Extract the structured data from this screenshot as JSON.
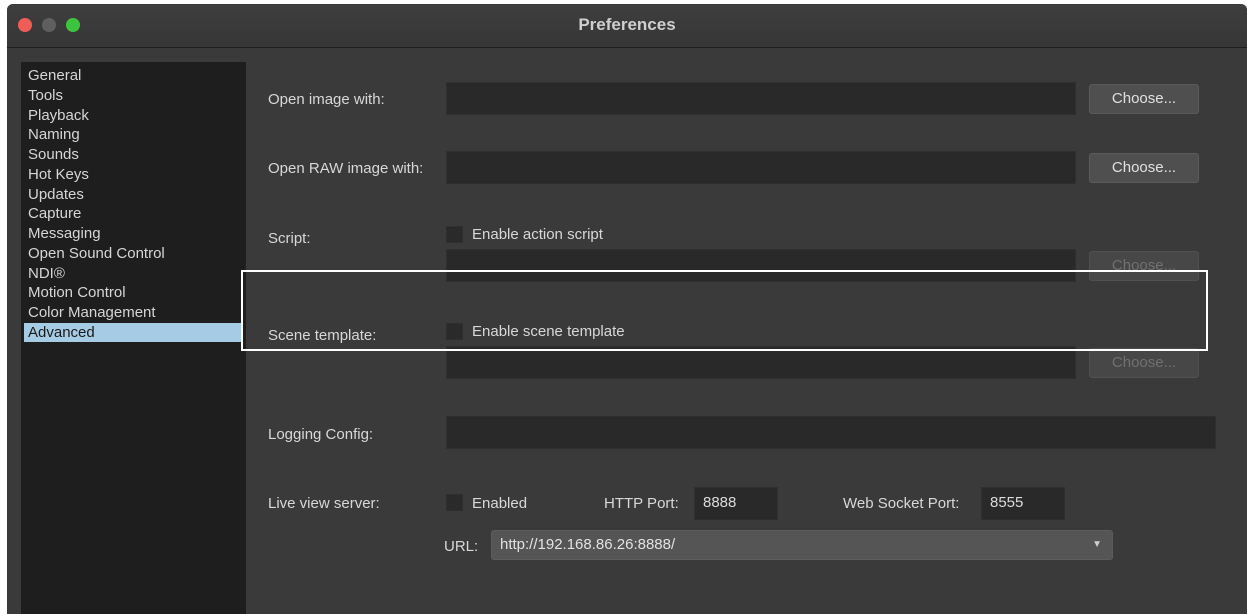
{
  "window": {
    "title": "Preferences"
  },
  "colors": {
    "close": "#ee5e56",
    "minimize": "#5f5f5f",
    "zoom": "#3cc43f",
    "selection": "#a6cbe5",
    "highlight_frame": "#ffffff"
  },
  "sidebar": {
    "items": [
      {
        "label": "General"
      },
      {
        "label": "Tools"
      },
      {
        "label": "Playback"
      },
      {
        "label": "Naming"
      },
      {
        "label": "Sounds"
      },
      {
        "label": "Hot Keys"
      },
      {
        "label": "Updates"
      },
      {
        "label": "Capture"
      },
      {
        "label": "Messaging"
      },
      {
        "label": "Open Sound Control"
      },
      {
        "label": "NDI®"
      },
      {
        "label": "Motion Control"
      },
      {
        "label": "Color Management"
      },
      {
        "label": "Advanced",
        "selected": true
      }
    ]
  },
  "advanced": {
    "open_image": {
      "label": "Open image with:",
      "value": "",
      "button": "Choose..."
    },
    "open_raw": {
      "label": "Open RAW image with:",
      "value": "",
      "button": "Choose..."
    },
    "script": {
      "label": "Script:",
      "checkbox_label": "Enable action script",
      "checked": false,
      "value": "",
      "button": "Choose..."
    },
    "scene_template": {
      "label": "Scene template:",
      "checkbox_label": "Enable scene template",
      "checked": false,
      "value": "",
      "button": "Choose..."
    },
    "logging": {
      "label": "Logging Config:",
      "value": ""
    },
    "live_view": {
      "label": "Live view server:",
      "enabled_label": "Enabled",
      "enabled": false,
      "http_port_label": "HTTP Port:",
      "http_port": "8888",
      "ws_port_label": "Web Socket Port:",
      "ws_port": "8555",
      "url_label": "URL:",
      "url": "http://192.168.86.26:8888/"
    }
  }
}
